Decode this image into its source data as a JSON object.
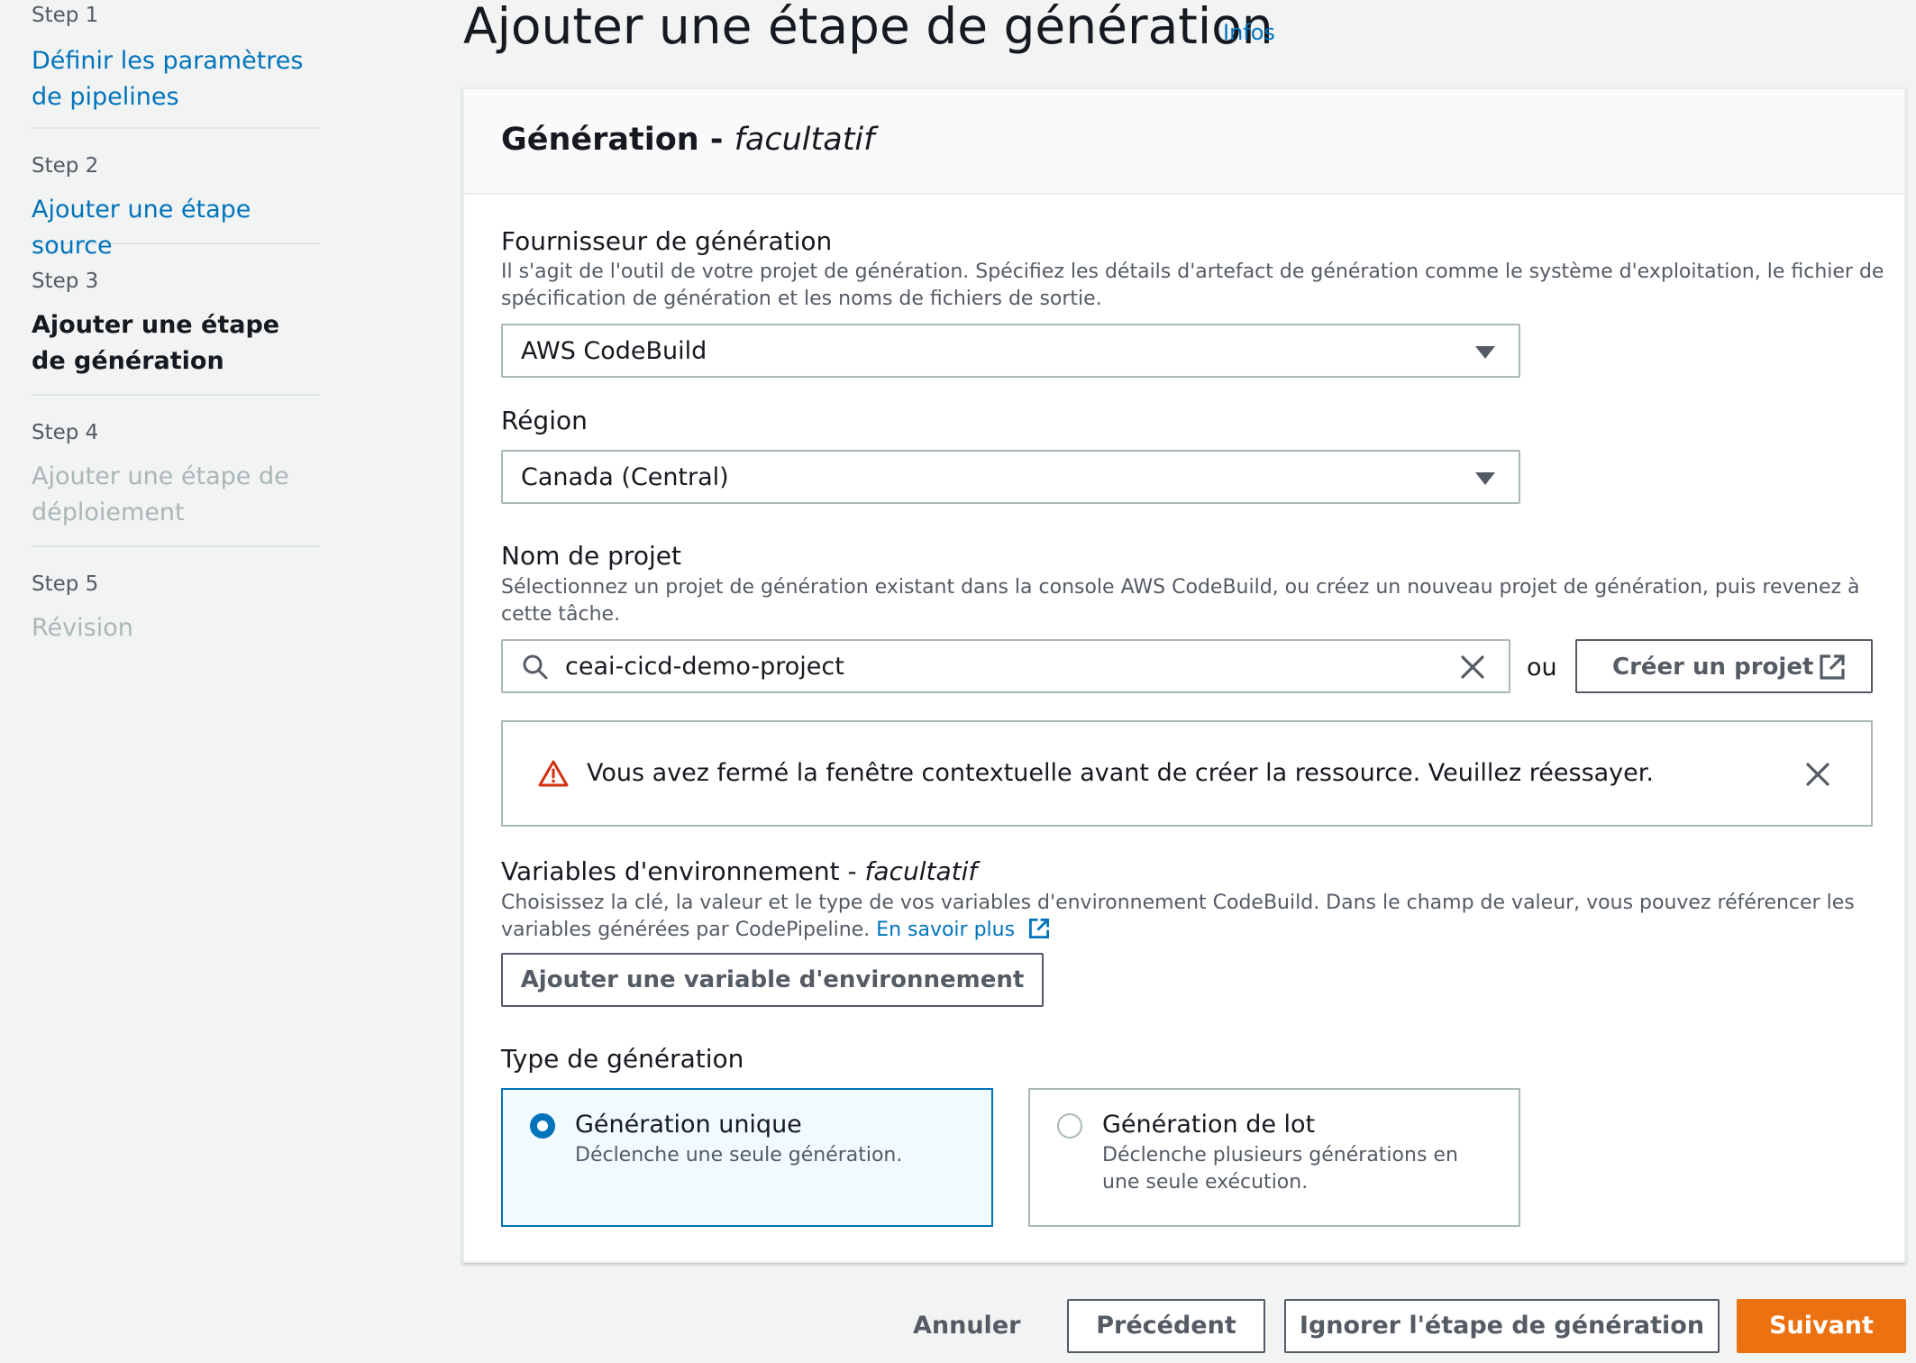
{
  "sidebar": {
    "steps": [
      {
        "number": "Step 1",
        "title": "Définir les paramètres de pipelines",
        "state": "link"
      },
      {
        "number": "Step 2",
        "title": "Ajouter une étape source",
        "state": "link"
      },
      {
        "number": "Step 3",
        "title": "Ajouter une étape de génération",
        "state": "current"
      },
      {
        "number": "Step 4",
        "title": "Ajouter une étape de déploiement",
        "state": "disabled"
      },
      {
        "number": "Step 5",
        "title": "Révision",
        "state": "disabled"
      }
    ]
  },
  "header": {
    "title": "Ajouter une étape de génération",
    "info_link": "Infos"
  },
  "panel": {
    "title": "Génération",
    "title_separator": " - ",
    "title_optional": "facultatif",
    "provider": {
      "label": "Fournisseur de génération",
      "description": "Il s'agit de l'outil de votre projet de génération. Spécifiez les détails d'artefact de génération comme le système d'exploitation, le fichier de spécification de génération et les noms de fichiers de sortie.",
      "value": "AWS CodeBuild"
    },
    "region": {
      "label": "Région",
      "value": "Canada (Central)"
    },
    "project": {
      "label": "Nom de projet",
      "description": "Sélectionnez un projet de génération existant dans la console AWS CodeBuild, ou créez un nouveau projet de génération, puis revenez à cette tâche.",
      "value": "ceai-cicd-demo-project",
      "or_text": "ou",
      "create_button": "Créer un projet"
    },
    "alert": {
      "message": "Vous avez fermé la fenêtre contextuelle avant de créer la ressource. Veuillez réessayer."
    },
    "env_vars": {
      "label": "Variables d'environnement",
      "label_separator": " - ",
      "label_optional": "facultatif",
      "description": "Choisissez la clé, la valeur et le type de vos variables d'environnement CodeBuild. Dans le champ de valeur, vous pouvez référencer les variables générées par CodePipeline.",
      "learn_more": "En savoir plus",
      "add_button": "Ajouter une variable d'environnement"
    },
    "build_type": {
      "label": "Type de génération",
      "options": [
        {
          "label": "Génération unique",
          "description": "Déclenche une seule génération.",
          "selected": true
        },
        {
          "label": "Génération de lot",
          "description": "Déclenche plusieurs générations en une seule exécution.",
          "selected": false
        }
      ]
    }
  },
  "footer": {
    "cancel": "Annuler",
    "previous": "Précédent",
    "skip": "Ignorer l'étape de génération",
    "next": "Suivant"
  },
  "colors": {
    "link": "#0073bb",
    "primary": "#ec7211",
    "warning": "#d13212",
    "selected_bg": "#f1faff"
  },
  "icons": [
    "search-icon",
    "clear-icon",
    "external-link-icon",
    "warning-icon",
    "close-icon",
    "caret-down-icon"
  ]
}
